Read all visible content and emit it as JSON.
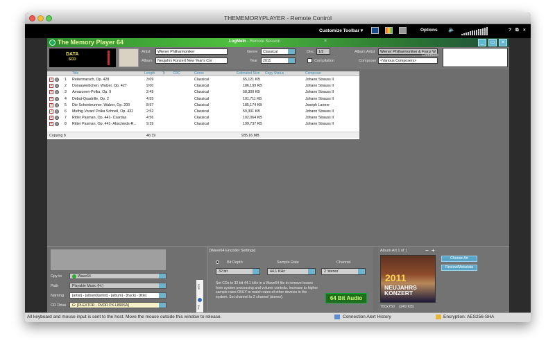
{
  "window": {
    "title": "THEMEMORYPLAYER - Remote Control"
  },
  "toolbar": {
    "customize_label": "Customize Toolbar",
    "options_label": "Options",
    "help_label": "?",
    "close_label": "×"
  },
  "app": {
    "title": "The Memory Player 64",
    "remote_brand": "LogMeIn",
    "remote_text": " - Remote Session",
    "header_close": "×"
  },
  "meta": {
    "datacd_logo": "DATA",
    "datacd_sub": "SCD",
    "artist_label": "Artist",
    "artist_value": "Wiener Philharmoniker",
    "album_label": "Album",
    "album_value": "Neujahrs Konzert New Year's Cor",
    "genre_label": "Genre",
    "genre_value": "Classical",
    "year_label": "Year",
    "year_value": "2011",
    "disc_label": "Disc",
    "disc_value": "1/2",
    "compilation_label": "Compilation",
    "album_artist_label": "Album Artist",
    "album_artist_value": "Wiener Philharmoniker & Franz W",
    "composer_label": "Composer",
    "composer_value": "<Various Composers>",
    "comment_label": "Comment"
  },
  "list": {
    "headers": [
      "Title",
      "Length",
      "Tr",
      "CRC",
      "Genre",
      "Estimated Size",
      "Copy Status",
      "Composer"
    ],
    "rows": [
      {
        "n": "1",
        "title": "Reitermarsch, Op. 428",
        "length": "3:09",
        "genre": "Classical",
        "size": "65,121 KB",
        "composer": "Johann Strauss II"
      },
      {
        "n": "2",
        "title": "Donauweibchen. Walzer, Op. 427",
        "length": "9:00",
        "genre": "Classical",
        "size": "186,199 KB",
        "composer": "Johann Strauss II"
      },
      {
        "n": "3",
        "title": "Amazonen-Polka, Op. 9",
        "length": "2:49",
        "genre": "Classical",
        "size": "58,300 KB",
        "composer": "Johann Strauss II"
      },
      {
        "n": "4",
        "title": "Debut-Quadrille, Op. 2",
        "length": "4:55",
        "genre": "Classical",
        "size": "101,711 KB",
        "composer": "Johann Strauss II"
      },
      {
        "n": "5",
        "title": "Die Schonbrunner. Walzer, Op. 200",
        "length": "8:57",
        "genre": "Classical",
        "size": "185,174 KB",
        "composer": "Joseph Lanner"
      },
      {
        "n": "6",
        "title": "Muthig Voran! Polka Schnell, Op. 432",
        "length": "2:52",
        "genre": "Classical",
        "size": "59,301 KB",
        "composer": "Johann Strauss II"
      },
      {
        "n": "7",
        "title": "Ritter Pasman, Op. 441- Csardas",
        "length": "4:56",
        "genre": "Classical",
        "size": "102,064 KB",
        "composer": "Johann Strauss II"
      },
      {
        "n": "8",
        "title": "Ritter Pasman, Op. 441- Abschieds-R...",
        "length": "9:39",
        "genre": "Classical",
        "size": "199,737 KB",
        "composer": "Johann Strauss II"
      }
    ],
    "footer_status": "Copying 8",
    "footer_length": "46:19",
    "footer_size": "935.16 MB"
  },
  "bottom": {
    "cpy_to_label": "Cpy to",
    "cpy_to_value": "Wave64",
    "path_label": "Path",
    "path_value": "Playable Music (H:)",
    "naming_label": "Naming",
    "naming_value": "[artist] - [album]\\[artist] - [album] - [track] - [title]",
    "cd_drive_label": "CD Drive",
    "cd_drive_value": "G: [PLEXTOR - DVDR   PX-L890SA]",
    "side_tab_1": "DSP",
    "side_tab_2": "Enc"
  },
  "encoder": {
    "title": "[Wave64 Encoder Settings]",
    "bit_depth_label": "Bit Depth",
    "bit_depth_value": "32 bit",
    "sample_rate_label": "Sample Rate",
    "sample_rate_value": "44.1 KHz",
    "channel_label": "Channel",
    "channel_value": "2 'stereo'",
    "description": "Set CDs to 32 bit 44.1 kHz in a Wave64 file to remove losses from system processing and volume controls. Increase to higher sample rates ONLY to match rates of other devices in the system. Set channel to 2 channel (stereo).",
    "badge": "64 Bit Audio"
  },
  "album_art": {
    "title": "Album Art 1 of 1",
    "remove_symbol": "−",
    "add_symbol": "+",
    "cover_year": "2011",
    "cover_title": "NEUJAHRS KONZERT",
    "dimensions": "750x750",
    "file_size": "(249 KB)",
    "choose_button": "Choose Art",
    "review_button": "Review/Metadata"
  },
  "status": {
    "message": "All keyboard and mouse input is sent to the host. Move the mouse outside this window to release.",
    "connection": "Connection Alert History",
    "encryption": "Encryption: AES256-SHA"
  },
  "colors": {
    "accent_green": "#4fbf3f",
    "accent_blue": "#5aa6c8",
    "title_yellow": "#e9f6a0"
  }
}
